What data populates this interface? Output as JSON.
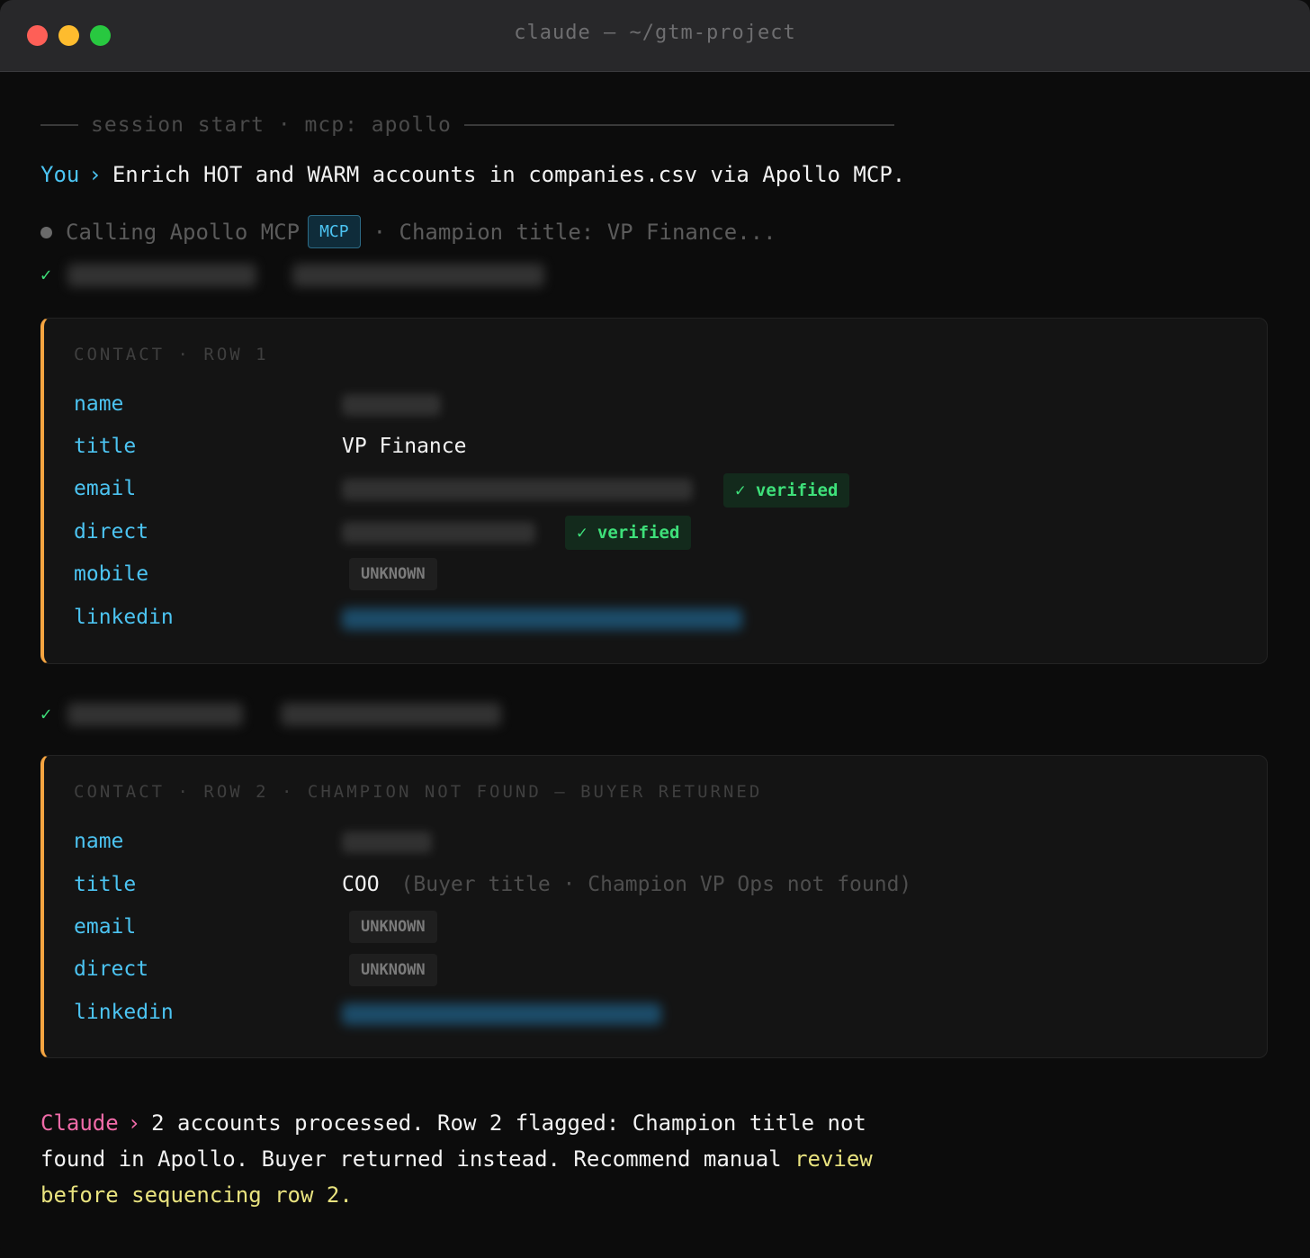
{
  "window": {
    "title": "claude — ~/gtm-project"
  },
  "session": {
    "label": "session start · mcp: apollo"
  },
  "prompt": {
    "speaker": "You",
    "arrow": "›",
    "text": "Enrich HOT and WARM accounts in companies.csv via Apollo MCP."
  },
  "calling": {
    "text": "Calling Apollo MCP",
    "badge": "MCP",
    "detail": "· Champion title: VP Finance..."
  },
  "result_mark": "✓",
  "cards": [
    {
      "header": "CONTACT · ROW 1",
      "rows": [
        {
          "key": "name"
        },
        {
          "key": "title",
          "value": "VP Finance"
        },
        {
          "key": "email",
          "status": "✓ verified"
        },
        {
          "key": "direct",
          "status": "✓ verified"
        },
        {
          "key": "mobile",
          "status": "UNKNOWN"
        },
        {
          "key": "linkedin"
        }
      ]
    },
    {
      "header": "CONTACT · ROW 2 · CHAMPION NOT FOUND — BUYER RETURNED",
      "rows": [
        {
          "key": "name"
        },
        {
          "key": "title",
          "value": "COO",
          "note": "(Buyer title · Champion VP Ops not found)"
        },
        {
          "key": "email",
          "status": "UNKNOWN"
        },
        {
          "key": "direct",
          "status": "UNKNOWN"
        },
        {
          "key": "linkedin"
        }
      ]
    }
  ],
  "final": {
    "speaker": "Claude",
    "arrow": "›",
    "text": "2 accounts processed. Row 2 flagged: Champion title not found in Apollo. Buyer returned instead. Recommend manual",
    "highlight": "review before sequencing row 2."
  },
  "colors": {
    "accent": "#4cc4f2",
    "verified": "#3ee07a",
    "card_border": "#f4a441",
    "claude": "#f06ba8",
    "highlight": "#e9e37f"
  }
}
